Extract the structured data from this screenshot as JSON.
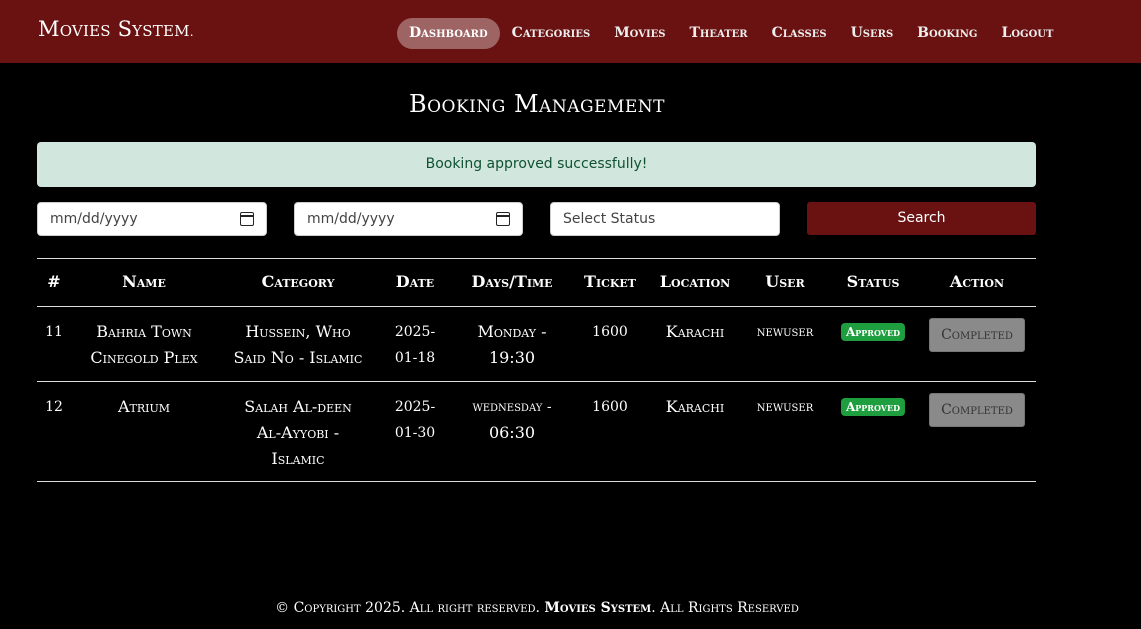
{
  "brand": {
    "name": "Movies System",
    "suffix": "."
  },
  "nav": {
    "items": [
      {
        "label": "Dashboard"
      },
      {
        "label": "Categories"
      },
      {
        "label": "Movies"
      },
      {
        "label": "Theater"
      },
      {
        "label": "Classes"
      },
      {
        "label": "Users"
      },
      {
        "label": "Booking"
      },
      {
        "label": "Logout"
      }
    ]
  },
  "page": {
    "title": "Booking Management"
  },
  "alert": {
    "message": "Booking approved successfully!"
  },
  "filters": {
    "date_from_placeholder": "mm/dd/yyyy",
    "date_to_placeholder": "mm/dd/yyyy",
    "status_placeholder": "Select Status",
    "search_label": "Search"
  },
  "table": {
    "headers": [
      "#",
      "Name",
      "Category",
      "Date",
      "Days/Time",
      "Ticket",
      "Location",
      "User",
      "Status",
      "Action"
    ],
    "rows": [
      {
        "id": "11",
        "name_line1": "Bahria Town",
        "name_line2": "Cinegold Plex",
        "category_line1": "Hussein, Who",
        "category_line2": "Said No - Islamic",
        "date_line1": "2025-",
        "date_line2": "01-18",
        "time_line1": "Monday -",
        "time_line2": "19:30",
        "ticket": "1600",
        "location": "Karachi",
        "user": "newuser",
        "status": "Approved",
        "action": "Completed"
      },
      {
        "id": "12",
        "name_line1": "Atrium",
        "category_line1": "Salah Al-deen",
        "category_line2": "Al-Ayyobi -",
        "category_line3": "Islamic",
        "date_line1": "2025-",
        "date_line2": "01-30",
        "time_line1": "wednesday -",
        "time_line2": "06:30",
        "ticket": "1600",
        "location": "Karachi",
        "user": "newuser",
        "status": "Approved",
        "action": "Completed"
      }
    ]
  },
  "footer": {
    "prefix": "© Copyright 2025. All right reserved. ",
    "brand": "Movies System",
    "suffix": ". All Rights Reserved"
  },
  "colors": {
    "accent": "#6a1111",
    "alert_bg": "#d1e7dd",
    "alert_text": "#0f5132",
    "badge": "#1e9e3e"
  }
}
